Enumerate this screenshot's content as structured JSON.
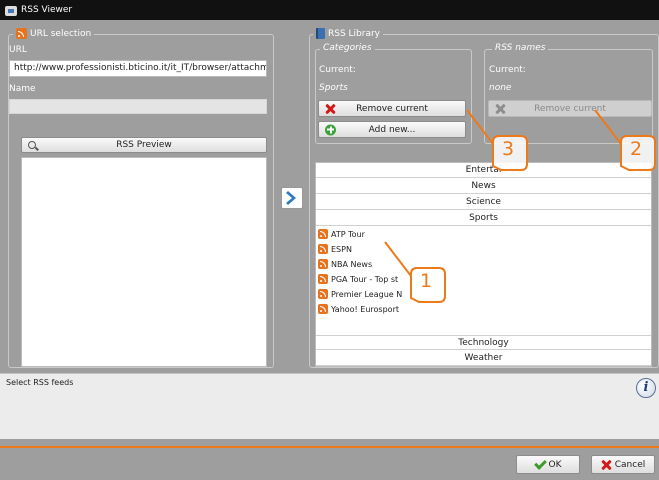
{
  "titlebar": {
    "title": "RSS Viewer"
  },
  "url_selection": {
    "legend": "URL selection",
    "url_label": "URL",
    "url_value": "http://www.professionisti.bticino.it/it_IT/browser/attachmen",
    "name_label": "Name",
    "name_value": "",
    "preview_button": "RSS Preview"
  },
  "transfer": {
    "icon": "chevron-right-icon"
  },
  "library": {
    "legend": "RSS Library",
    "categories": {
      "heading": "Categories",
      "current_label": "Current:",
      "current_value": "Sports",
      "remove_button": "Remove current",
      "add_button": "Add new..."
    },
    "rss_names": {
      "heading": "RSS names",
      "current_label": "Current:",
      "current_value": "none",
      "remove_button": "Remove current"
    },
    "category_list_top": [
      "Entertai",
      "News",
      "Science",
      "Sports"
    ],
    "feeds": [
      "ATP Tour",
      "ESPN",
      "NBA News",
      "PGA Tour - Top st",
      "Premier League N",
      "Yahoo! Eurosport"
    ],
    "category_list_bottom": [
      "Technology",
      "Weather"
    ]
  },
  "status": {
    "text": "Select RSS feeds",
    "info_icon": "i"
  },
  "footer": {
    "ok_button": "OK",
    "cancel_button": "Cancel"
  },
  "callouts": [
    "1",
    "2",
    "3"
  ],
  "colors": {
    "accent": "#ec7a1a",
    "window_bg": "#9e9e9e",
    "titlebar": "#111111"
  }
}
